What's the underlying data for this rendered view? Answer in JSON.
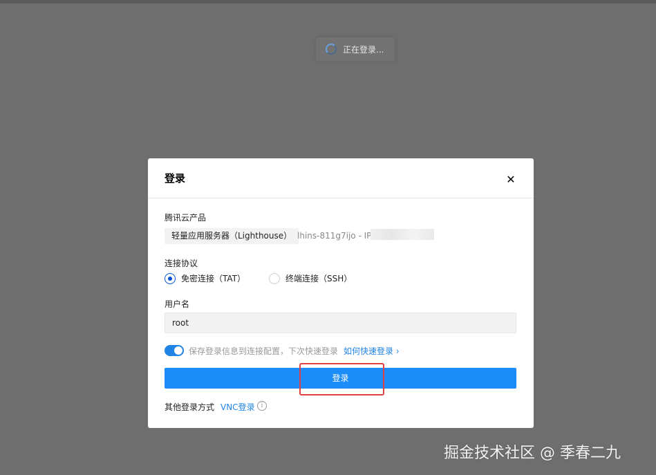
{
  "toast": {
    "text": "正在登录..."
  },
  "dialog": {
    "title": "登录",
    "close_icon": "close-icon",
    "product_label": "腾讯云产品",
    "product_tag": "轻量应用服务器（Lighthouse）",
    "instance": "lhins-811g7ijo - IP: 1",
    "protocol_label": "连接协议",
    "protocols": [
      {
        "label": "免密连接（TAT）",
        "checked": true
      },
      {
        "label": "终端连接（SSH）",
        "checked": false
      }
    ],
    "username_label": "用户名",
    "username_value": "root",
    "save_toggle_text": "保存登录信息到连接配置，下次快速登录",
    "quick_login_link": "如何快速登录 ›",
    "login_button": "登录",
    "other_label": "其他登录方式",
    "vnc_link": "VNC登录",
    "info_icon_glyph": "i"
  },
  "watermark": "掘金技术社区 @ 季春二九",
  "colors": {
    "overlay": "#6e6e6e",
    "primary": "#1b8cf8",
    "link": "#1f84e6",
    "highlight": "#e04141"
  }
}
